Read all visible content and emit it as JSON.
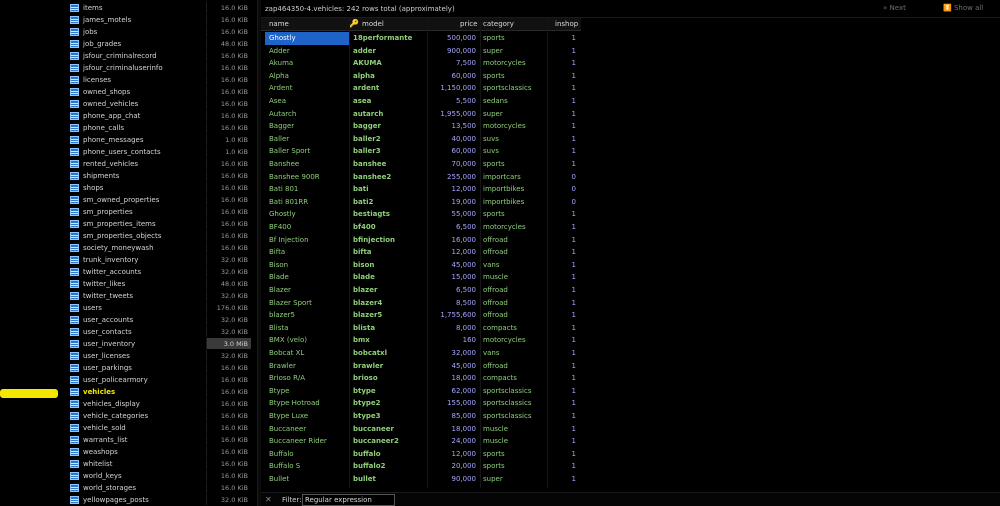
{
  "window": {
    "title": "zap464350-4.vehicles: 242 rows total (approximately)",
    "next_label": "Next",
    "show_all_label": "Show all"
  },
  "tables": [
    {
      "name": "items",
      "size": "16.0 KiB"
    },
    {
      "name": "james_motels",
      "size": "16.0 KiB"
    },
    {
      "name": "jobs",
      "size": "16.0 KiB"
    },
    {
      "name": "job_grades",
      "size": "48.0 KiB"
    },
    {
      "name": "jsfour_criminalrecord",
      "size": "16.0 KiB"
    },
    {
      "name": "jsfour_criminaluserinfo",
      "size": "16.0 KiB"
    },
    {
      "name": "licenses",
      "size": "16.0 KiB"
    },
    {
      "name": "owned_shops",
      "size": "16.0 KiB"
    },
    {
      "name": "owned_vehicles",
      "size": "16.0 KiB"
    },
    {
      "name": "phone_app_chat",
      "size": "16.0 KiB"
    },
    {
      "name": "phone_calls",
      "size": "16.0 KiB"
    },
    {
      "name": "phone_messages",
      "size": "1.0 KiB"
    },
    {
      "name": "phone_users_contacts",
      "size": "1.0 KiB"
    },
    {
      "name": "rented_vehicles",
      "size": "16.0 KiB"
    },
    {
      "name": "shipments",
      "size": "16.0 KiB"
    },
    {
      "name": "shops",
      "size": "16.0 KiB"
    },
    {
      "name": "sm_owned_properties",
      "size": "16.0 KiB"
    },
    {
      "name": "sm_properties",
      "size": "16.0 KiB"
    },
    {
      "name": "sm_properties_items",
      "size": "16.0 KiB"
    },
    {
      "name": "sm_properties_objects",
      "size": "16.0 KiB"
    },
    {
      "name": "society_moneywash",
      "size": "16.0 KiB"
    },
    {
      "name": "trunk_inventory",
      "size": "32.0 KiB"
    },
    {
      "name": "twitter_accounts",
      "size": "32.0 KiB"
    },
    {
      "name": "twitter_likes",
      "size": "48.0 KiB"
    },
    {
      "name": "twitter_tweets",
      "size": "32.0 KiB"
    },
    {
      "name": "users",
      "size": "176.0 KiB"
    },
    {
      "name": "user_accounts",
      "size": "32.0 KiB"
    },
    {
      "name": "user_contacts",
      "size": "32.0 KiB"
    },
    {
      "name": "user_inventory",
      "size": "3.0 MiB"
    },
    {
      "name": "user_licenses",
      "size": "32.0 KiB"
    },
    {
      "name": "user_parkings",
      "size": "16.0 KiB"
    },
    {
      "name": "user_policearmory",
      "size": "16.0 KiB"
    },
    {
      "name": "vehicles",
      "size": "16.0 KiB"
    },
    {
      "name": "vehicles_display",
      "size": "16.0 KiB"
    },
    {
      "name": "vehicle_categories",
      "size": "16.0 KiB"
    },
    {
      "name": "vehicle_sold",
      "size": "16.0 KiB"
    },
    {
      "name": "warrants_list",
      "size": "16.0 KiB"
    },
    {
      "name": "weashops",
      "size": "16.0 KiB"
    },
    {
      "name": "whitelist",
      "size": "16.0 KiB"
    },
    {
      "name": "world_keys",
      "size": "16.0 KiB"
    },
    {
      "name": "world_storages",
      "size": "16.0 KiB"
    },
    {
      "name": "yellowpages_posts",
      "size": "32.0 KiB"
    }
  ],
  "active_table": "vehicles",
  "columns": [
    "name",
    "model",
    "price",
    "category",
    "inshop"
  ],
  "rows": [
    [
      "Ghostly",
      "18performante",
      "500,000",
      "sports",
      "1"
    ],
    [
      "Adder",
      "adder",
      "900,000",
      "super",
      "1"
    ],
    [
      "Akuma",
      "AKUMA",
      "7,500",
      "motorcycles",
      "1"
    ],
    [
      "Alpha",
      "alpha",
      "60,000",
      "sports",
      "1"
    ],
    [
      "Ardent",
      "ardent",
      "1,150,000",
      "sportsclassics",
      "1"
    ],
    [
      "Asea",
      "asea",
      "5,500",
      "sedans",
      "1"
    ],
    [
      "Autarch",
      "autarch",
      "1,955,000",
      "super",
      "1"
    ],
    [
      "Bagger",
      "bagger",
      "13,500",
      "motorcycles",
      "1"
    ],
    [
      "Baller",
      "baller2",
      "40,000",
      "suvs",
      "1"
    ],
    [
      "Baller Sport",
      "baller3",
      "60,000",
      "suvs",
      "1"
    ],
    [
      "Banshee",
      "banshee",
      "70,000",
      "sports",
      "1"
    ],
    [
      "Banshee 900R",
      "banshee2",
      "255,000",
      "importcars",
      "0"
    ],
    [
      "Bati 801",
      "bati",
      "12,000",
      "importbikes",
      "0"
    ],
    [
      "Bati 801RR",
      "bati2",
      "19,000",
      "importbikes",
      "0"
    ],
    [
      "Ghostly",
      "bestiagts",
      "55,000",
      "sports",
      "1"
    ],
    [
      "BF400",
      "bf400",
      "6,500",
      "motorcycles",
      "1"
    ],
    [
      "Bf Injection",
      "bfinjection",
      "16,000",
      "offroad",
      "1"
    ],
    [
      "Bifta",
      "bifta",
      "12,000",
      "offroad",
      "1"
    ],
    [
      "Bison",
      "bison",
      "45,000",
      "vans",
      "1"
    ],
    [
      "Blade",
      "blade",
      "15,000",
      "muscle",
      "1"
    ],
    [
      "Blazer",
      "blazer",
      "6,500",
      "offroad",
      "1"
    ],
    [
      "Blazer Sport",
      "blazer4",
      "8,500",
      "offroad",
      "1"
    ],
    [
      "blazer5",
      "blazer5",
      "1,755,600",
      "offroad",
      "1"
    ],
    [
      "Blista",
      "blista",
      "8,000",
      "compacts",
      "1"
    ],
    [
      "BMX (velo)",
      "bmx",
      "160",
      "motorcycles",
      "1"
    ],
    [
      "Bobcat XL",
      "bobcatxl",
      "32,000",
      "vans",
      "1"
    ],
    [
      "Brawler",
      "brawler",
      "45,000",
      "offroad",
      "1"
    ],
    [
      "Brioso R/A",
      "brioso",
      "18,000",
      "compacts",
      "1"
    ],
    [
      "Btype",
      "btype",
      "62,000",
      "sportsclassics",
      "1"
    ],
    [
      "Btype Hotroad",
      "btype2",
      "155,000",
      "sportsclassics",
      "1"
    ],
    [
      "Btype Luxe",
      "btype3",
      "85,000",
      "sportsclassics",
      "1"
    ],
    [
      "Buccaneer",
      "buccaneer",
      "18,000",
      "muscle",
      "1"
    ],
    [
      "Buccaneer Rider",
      "buccaneer2",
      "24,000",
      "muscle",
      "1"
    ],
    [
      "Buffalo",
      "buffalo",
      "12,000",
      "sports",
      "1"
    ],
    [
      "Buffalo S",
      "buffalo2",
      "20,000",
      "sports",
      "1"
    ],
    [
      "Bullet",
      "bullet",
      "90,000",
      "super",
      "1"
    ]
  ],
  "filter": {
    "label": "Filter:",
    "placeholder": "Regular expression",
    "close_glyph": "✕"
  }
}
